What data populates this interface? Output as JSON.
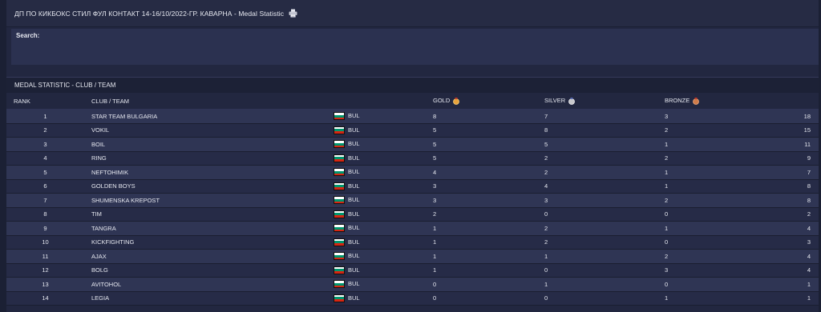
{
  "header": {
    "title": "ДП ПО КИКБОКС СТИЛ ФУЛ КОНТАКТ 14-16/10/2022-ГР. КАВАРНА - Medal Statistic"
  },
  "search": {
    "label": "Search:"
  },
  "section": {
    "title": "MEDAL STATISTIC - CLUB / TEAM"
  },
  "table": {
    "columns": {
      "rank": "RANK",
      "club": "CLUB / TEAM",
      "gold": "GOLD",
      "silver": "SILVER",
      "bronze": "BRONZE"
    },
    "rows": [
      {
        "rank": "1",
        "club": "STAR TEAM BULGARIA",
        "country": "BUL",
        "gold": "8",
        "silver": "7",
        "bronze": "3",
        "total": "18"
      },
      {
        "rank": "2",
        "club": "VOKIL",
        "country": "BUL",
        "gold": "5",
        "silver": "8",
        "bronze": "2",
        "total": "15"
      },
      {
        "rank": "3",
        "club": "BOIL",
        "country": "BUL",
        "gold": "5",
        "silver": "5",
        "bronze": "1",
        "total": "11"
      },
      {
        "rank": "4",
        "club": "RING",
        "country": "BUL",
        "gold": "5",
        "silver": "2",
        "bronze": "2",
        "total": "9"
      },
      {
        "rank": "5",
        "club": "NEFTOHIMIK",
        "country": "BUL",
        "gold": "4",
        "silver": "2",
        "bronze": "1",
        "total": "7"
      },
      {
        "rank": "6",
        "club": "GOLDEN BOYS",
        "country": "BUL",
        "gold": "3",
        "silver": "4",
        "bronze": "1",
        "total": "8"
      },
      {
        "rank": "7",
        "club": "SHUMENSKA KREPOST",
        "country": "BUL",
        "gold": "3",
        "silver": "3",
        "bronze": "2",
        "total": "8"
      },
      {
        "rank": "8",
        "club": "TIM",
        "country": "BUL",
        "gold": "2",
        "silver": "0",
        "bronze": "0",
        "total": "2"
      },
      {
        "rank": "9",
        "club": "TANGRA",
        "country": "BUL",
        "gold": "1",
        "silver": "2",
        "bronze": "1",
        "total": "4"
      },
      {
        "rank": "10",
        "club": "KICKFIGHTING",
        "country": "BUL",
        "gold": "1",
        "silver": "2",
        "bronze": "0",
        "total": "3"
      },
      {
        "rank": "11",
        "club": "AJAX",
        "country": "BUL",
        "gold": "1",
        "silver": "1",
        "bronze": "2",
        "total": "4"
      },
      {
        "rank": "12",
        "club": "BOLG",
        "country": "BUL",
        "gold": "1",
        "silver": "0",
        "bronze": "3",
        "total": "4"
      },
      {
        "rank": "13",
        "club": "AVITOHOL",
        "country": "BUL",
        "gold": "0",
        "silver": "1",
        "bronze": "0",
        "total": "1"
      },
      {
        "rank": "14",
        "club": "LEGIA",
        "country": "BUL",
        "gold": "0",
        "silver": "0",
        "bronze": "1",
        "total": "1"
      }
    ]
  },
  "icons": {
    "print": "printer-icon",
    "gold": "gold-medal-icon",
    "silver": "silver-medal-icon",
    "bronze": "bronze-medal-icon",
    "flag": "bulgaria-flag-icon"
  },
  "colors": {
    "background": "#222740",
    "row_odd": "#2f3554",
    "row_even": "#262b47",
    "gold": "#e8a33c",
    "silver": "#c8c8cc",
    "bronze": "#d07c4a"
  }
}
